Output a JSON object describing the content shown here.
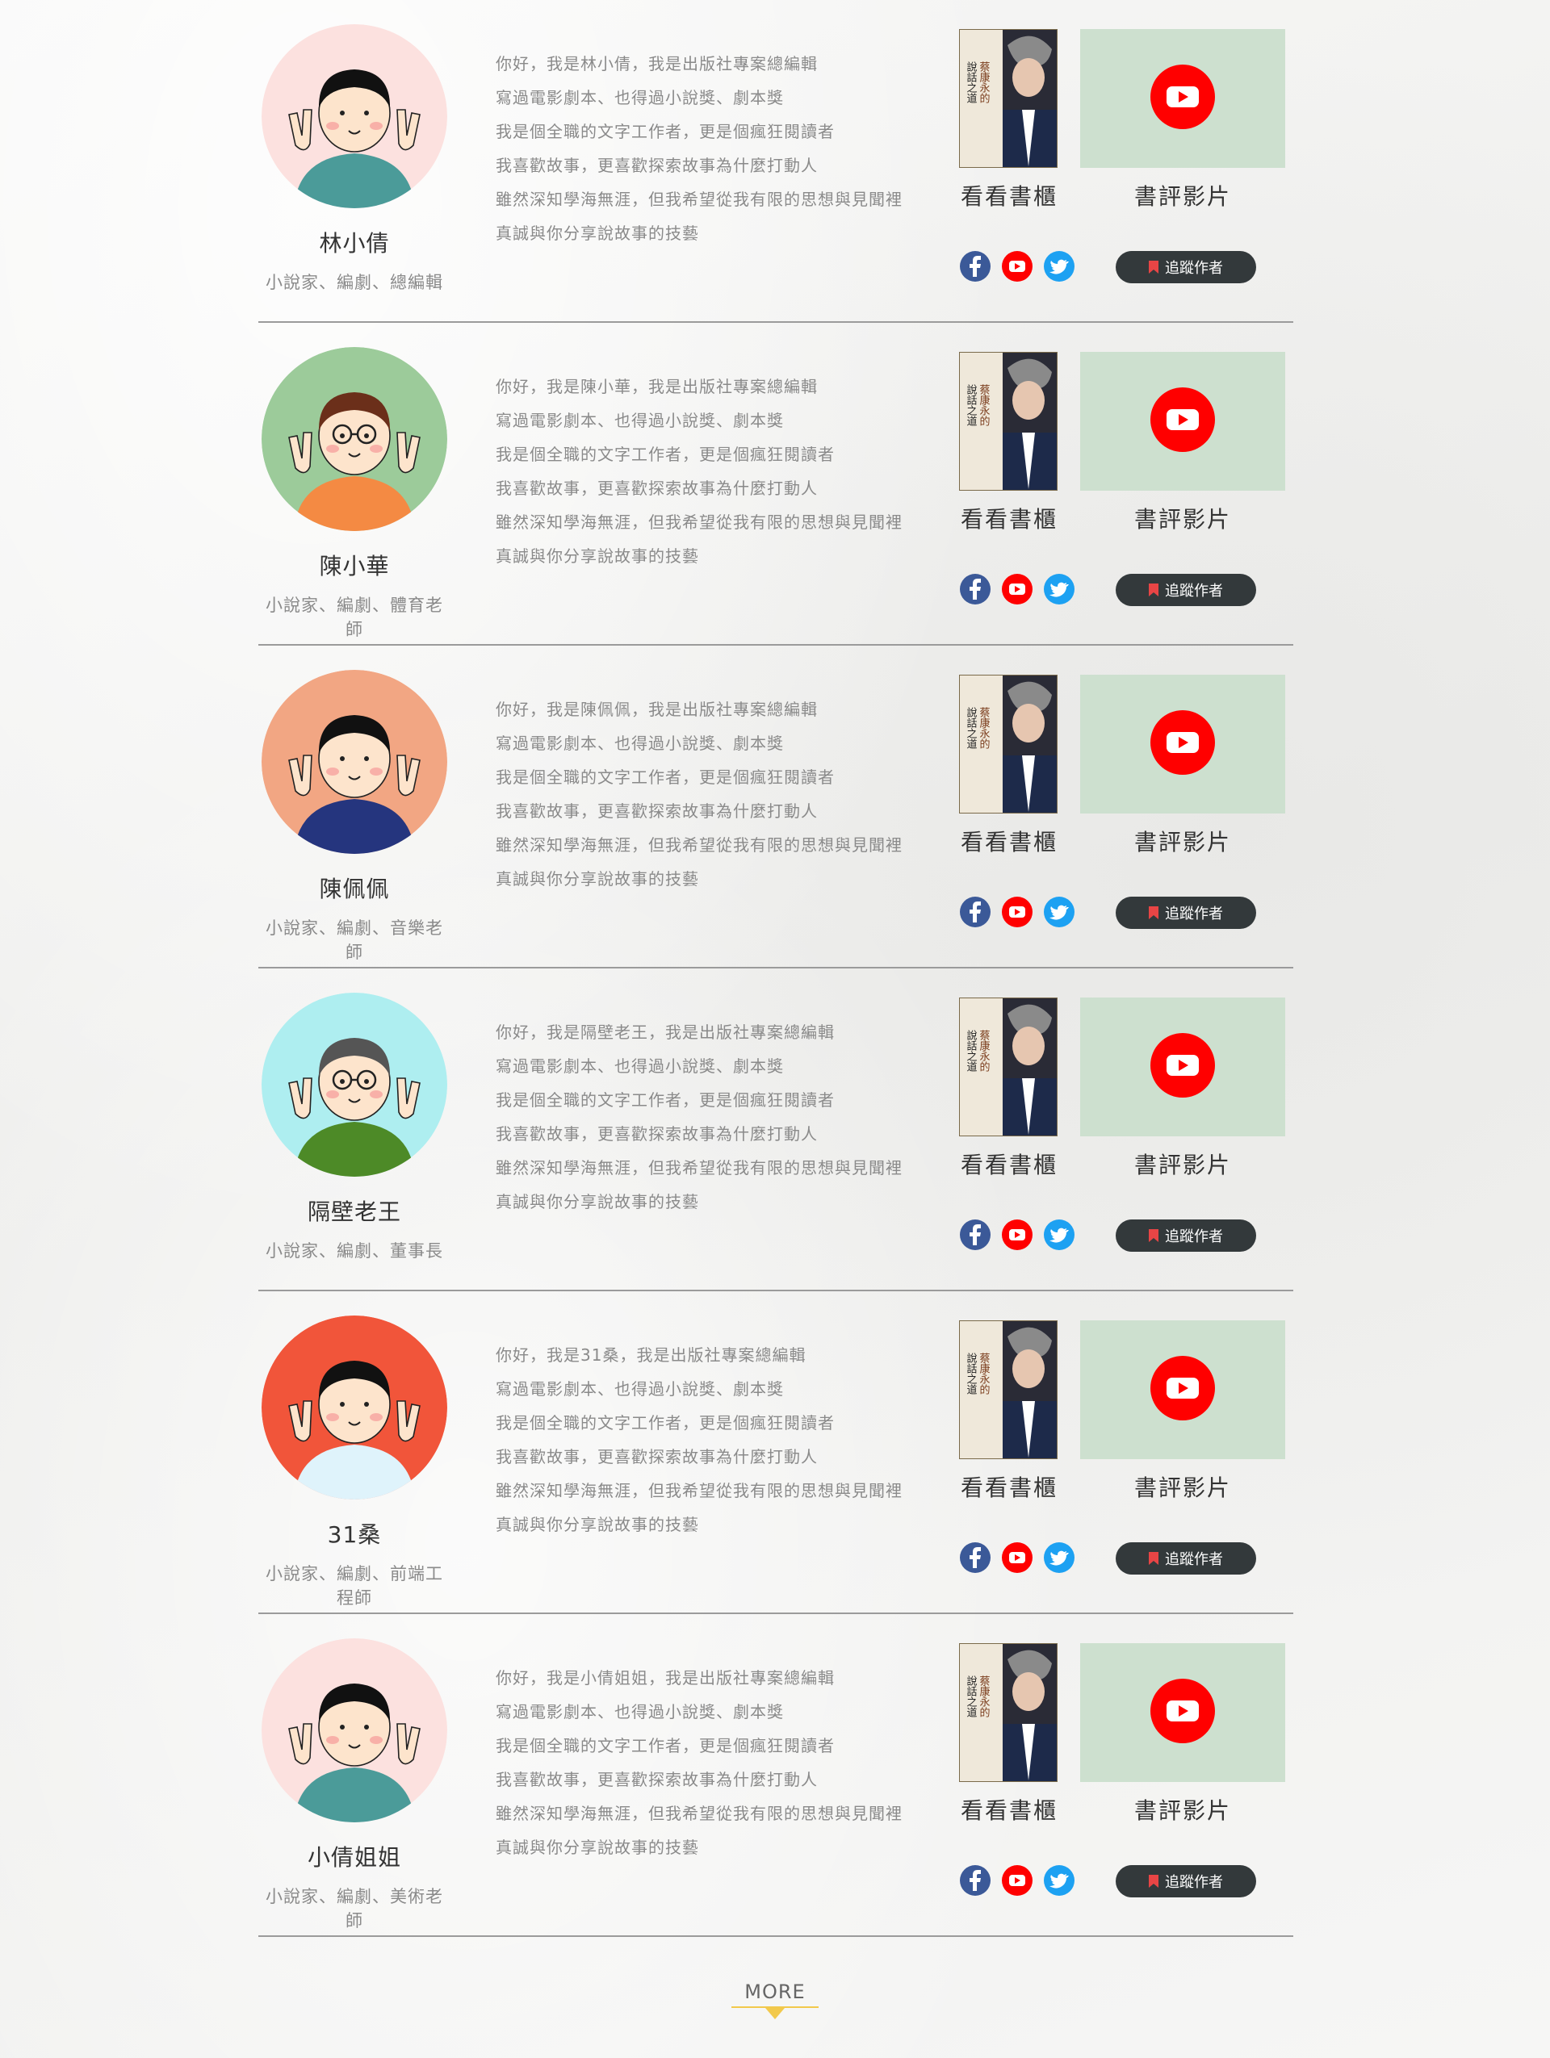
{
  "authors": [
    {
      "name": "林小倩",
      "title": "小說家、編劇、總編輯",
      "bio": [
        "你好，我是林小倩，我是出版社專案總編輯",
        "寫過電影劇本、也得過小說獎、劇本獎",
        "我是個全職的文字工作者，更是個瘋狂閱讀者",
        "我喜歡故事，更喜歡探索故事為什麼打動人",
        "雖然深知學海無涯，但我希望從我有限的思想與見聞裡",
        "真誠與你分享說故事的技藝"
      ],
      "avatar_bg": "#fce1df",
      "skin": "#fde4cc",
      "shirt": "#4b9b99",
      "hair": "#111111",
      "glasses": false
    },
    {
      "name": "陳小華",
      "title": "小說家、編劇、體育老師",
      "bio": [
        "你好，我是陳小華，我是出版社專案總編輯",
        "寫過電影劇本、也得過小說獎、劇本獎",
        "我是個全職的文字工作者，更是個瘋狂閱讀者",
        "我喜歡故事，更喜歡探索故事為什麼打動人",
        "雖然深知學海無涯，但我希望從我有限的思想與見聞裡",
        "真誠與你分享說故事的技藝"
      ],
      "avatar_bg": "#9ccb9a",
      "skin": "#fde4cc",
      "shirt": "#f48a43",
      "hair": "#6b2f1a",
      "glasses": true
    },
    {
      "name": "陳佩佩",
      "title": "小說家、編劇、音樂老師",
      "bio": [
        "你好，我是陳佩佩，我是出版社專案總編輯",
        "寫過電影劇本、也得過小說獎、劇本獎",
        "我是個全職的文字工作者，更是個瘋狂閱讀者",
        "我喜歡故事，更喜歡探索故事為什麼打動人",
        "雖然深知學海無涯，但我希望從我有限的思想與見聞裡",
        "真誠與你分享說故事的技藝"
      ],
      "avatar_bg": "#f2a683",
      "skin": "#fde4cc",
      "shirt": "#25357e",
      "hair": "#111111",
      "glasses": false
    },
    {
      "name": "隔壁老王",
      "title": "小說家、編劇、董事長",
      "bio": [
        "你好，我是隔壁老王，我是出版社專案總編輯",
        "寫過電影劇本、也得過小說獎、劇本獎",
        "我是個全職的文字工作者，更是個瘋狂閱讀者",
        "我喜歡故事，更喜歡探索故事為什麼打動人",
        "雖然深知學海無涯，但我希望從我有限的思想與見聞裡",
        "真誠與你分享說故事的技藝"
      ],
      "avatar_bg": "#aeeef0",
      "skin": "#fde4cc",
      "shirt": "#4d8a27",
      "hair": "#555555",
      "glasses": true
    },
    {
      "name": "31桑",
      "title": "小說家、編劇、前端工程師",
      "bio": [
        "你好，我是31桑，我是出版社專案總編輯",
        "寫過電影劇本、也得過小說獎、劇本獎",
        "我是個全職的文字工作者，更是個瘋狂閱讀者",
        "我喜歡故事，更喜歡探索故事為什麼打動人",
        "雖然深知學海無涯，但我希望從我有限的思想與見聞裡",
        "真誠與你分享說故事的技藝"
      ],
      "avatar_bg": "#f1553a",
      "skin": "#fde4cc",
      "shirt": "#dff3fb",
      "hair": "#111111",
      "glasses": false
    },
    {
      "name": "小倩姐姐",
      "title": "小說家、編劇、美術老師",
      "bio": [
        "你好，我是小倩姐姐，我是出版社專案總編輯",
        "寫過電影劇本、也得過小說獎、劇本獎",
        "我是個全職的文字工作者，更是個瘋狂閱讀者",
        "我喜歡故事，更喜歡探索故事為什麼打動人",
        "雖然深知學海無涯，但我希望從我有限的思想與見聞裡",
        "真誠與你分享說故事的技藝"
      ],
      "avatar_bg": "#fce1df",
      "skin": "#fde4cc",
      "shirt": "#4b9b99",
      "hair": "#111111",
      "glasses": false
    }
  ],
  "labels": {
    "bookshelf": "看看書櫃",
    "video": "書評影片",
    "follow": "追蹤作者",
    "more": "MORE"
  },
  "book_cover": {
    "title_lines": [
      "蔡康永的",
      "說話之道"
    ]
  },
  "social_icons": [
    "facebook-icon",
    "youtube-icon",
    "twitter-icon"
  ],
  "colors": {
    "follow_bg": "#33393b",
    "video_bg": "#cde0cf",
    "youtube_red": "#ff0000",
    "facebook_blue": "#3b5998",
    "twitter_blue": "#1da1f2",
    "more_underline": "#f2c94c",
    "divider": "#9b9b9b"
  }
}
